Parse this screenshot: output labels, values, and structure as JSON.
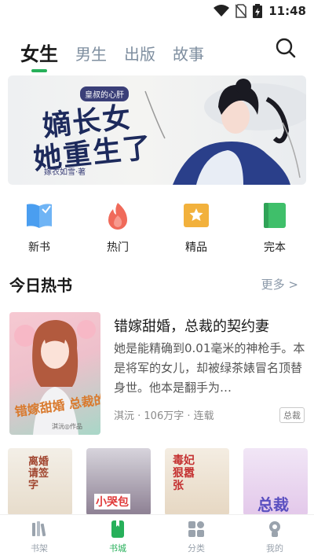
{
  "status_bar": {
    "time": "11:48"
  },
  "tabs": [
    {
      "label": "女生",
      "active": true
    },
    {
      "label": "男生"
    },
    {
      "label": "出版"
    },
    {
      "label": "故事"
    }
  ],
  "banner": {
    "tag": "皇叔的心肝",
    "title_line1": "嫡长女",
    "title_line2": "她重生了",
    "author": "嫁衣如雪·著"
  },
  "categories": [
    {
      "label": "新书",
      "icon": "book-open-icon",
      "color": "#4a9ef0"
    },
    {
      "label": "热门",
      "icon": "flame-icon",
      "color": "#f06a5a"
    },
    {
      "label": "精品",
      "icon": "star-bookmark-icon",
      "color": "#f2b13c"
    },
    {
      "label": "完本",
      "icon": "book-closed-icon",
      "color": "#3fbf6a"
    }
  ],
  "section": {
    "title": "今日热书",
    "more": "更多 >"
  },
  "featured": {
    "title": "错嫁甜婚，总裁的契约妻",
    "description": "她是能精确到0.01毫米的神枪手。本是将军的女儿，却被绿茶婊冒名顶替身世。他本是翻手为…",
    "meta": "淇沅 · 106万字 · 连载",
    "badge": "总裁",
    "cover_text": "错嫁甜婚 总裁的契约妻",
    "cover_author": "淇沅◎作品"
  },
  "covers": [
    {
      "text": "离婚请签字"
    },
    {
      "text": "小哭包"
    },
    {
      "text": "毒妃狠嚣张"
    },
    {
      "text": "总裁"
    }
  ],
  "nav": [
    {
      "label": "书架",
      "icon": "bookshelf-icon"
    },
    {
      "label": "书城",
      "icon": "bookstore-icon",
      "active": true
    },
    {
      "label": "分类",
      "icon": "category-grid-icon"
    },
    {
      "label": "我的",
      "icon": "profile-icon"
    }
  ],
  "colors": {
    "accent": "#27b05a",
    "muted": "#8a98a8"
  }
}
